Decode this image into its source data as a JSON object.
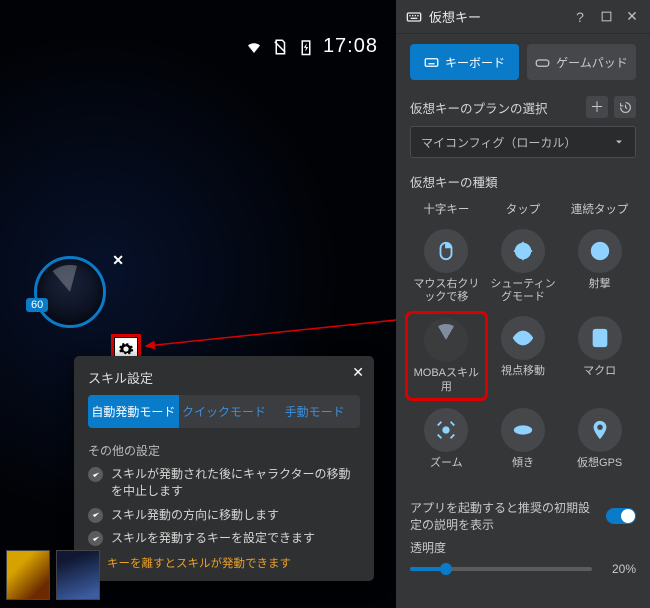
{
  "statusbar": {
    "time": "17:08"
  },
  "joystick": {
    "badge": "60"
  },
  "popup": {
    "title": "スキル設定",
    "modes": {
      "auto": "自動発動モード",
      "quick": "クイックモード",
      "manual": "手動モード"
    },
    "other_title": "その他の設定",
    "opt1": "スキルが発動された後にキャラクターの移動を中止します",
    "opt2": "スキル発動の方向に移動します",
    "opt3": "スキルを発動するキーを設定できます",
    "warn": "キーを離すとスキルが発動できます"
  },
  "panel": {
    "title": "仮想キー",
    "tab_keyboard": "キーボード",
    "tab_gamepad": "ゲームパッド",
    "plan_label": "仮想キーのプランの選択",
    "select_value": "マイコンフィグ（ローカル）",
    "types_label": "仮想キーの種類",
    "cats": {
      "cross": "十字キー",
      "tap": "タップ",
      "multitap": "連続タップ"
    },
    "controls": {
      "mouse_right": "マウス右クリックで移",
      "shooting": "シューティングモード",
      "shoot": "射撃",
      "moba": "MOBAスキル用",
      "view": "視点移動",
      "macro": "マクロ",
      "zoom": "ズーム",
      "tilt": "傾き",
      "gps": "仮想GPS"
    },
    "hint": "アプリを起動すると推奨の初期設定の説明を表示",
    "opacity_label": "透明度",
    "opacity_value": "20%",
    "opacity_pct": 20
  }
}
